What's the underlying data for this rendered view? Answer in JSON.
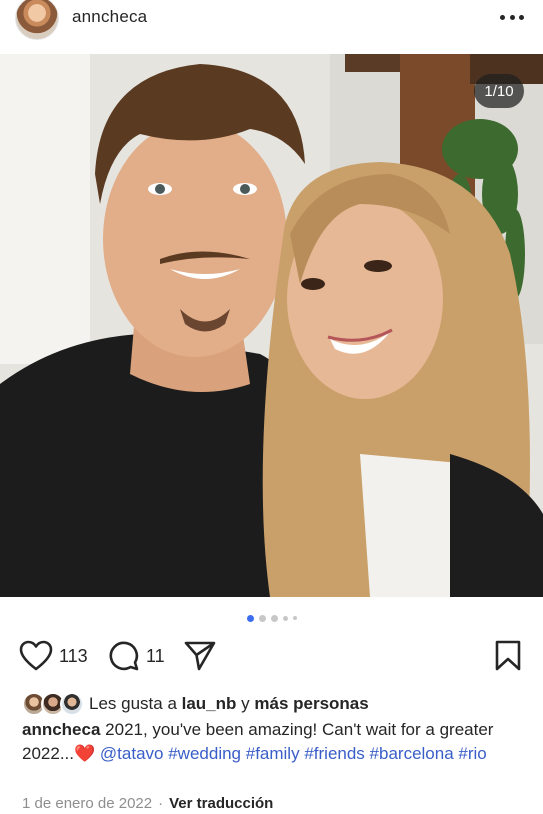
{
  "header": {
    "username": "anncheca"
  },
  "post": {
    "counter": "1/10",
    "current_image": 1,
    "total_images": 10
  },
  "actions": {
    "likes_count": "113",
    "comments_count": "11"
  },
  "liked_by": {
    "prefix": "Les gusta a ",
    "user": "lau_nb",
    "joiner": " y ",
    "others": "más personas"
  },
  "caption": {
    "author": "anncheca",
    "text": " 2021, you've been amazing! Can't wait for a greater 2022...",
    "emoji": "❤️",
    "mention": "@tatavo",
    "hashtags": [
      "#wedding",
      "#family",
      "#friends",
      "#barcelona",
      "#rio"
    ]
  },
  "meta": {
    "date": "1 de enero de 2022",
    "separator": "·",
    "translate_label": "Ver traducción"
  },
  "colors": {
    "link": "#3a5ec8",
    "active_dot": "#3c6df0",
    "heart": "#e0213c"
  }
}
